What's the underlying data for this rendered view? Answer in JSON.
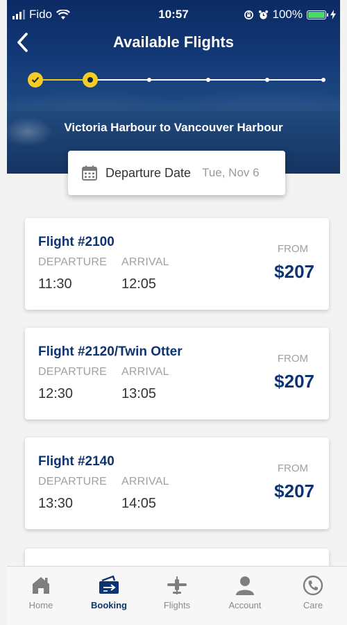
{
  "status_bar": {
    "carrier": "Fido",
    "time": "10:57",
    "battery": "100%"
  },
  "header": {
    "title": "Available Flights",
    "route": "Victoria Harbour to Vancouver Harbour",
    "progress": {
      "total_steps": 6,
      "completed_steps": 1,
      "current_step": 2
    }
  },
  "departure": {
    "label": "Departure Date",
    "value": "Tue, Nov 6"
  },
  "flights": [
    {
      "name": "Flight #2100",
      "departure_label": "DEPARTURE",
      "arrival_label": "ARRIVAL",
      "departure": "11:30",
      "arrival": "12:05",
      "from_label": "FROM",
      "price": "$207"
    },
    {
      "name": "Flight #2120/Twin Otter",
      "departure_label": "DEPARTURE",
      "arrival_label": "ARRIVAL",
      "departure": "12:30",
      "arrival": "13:05",
      "from_label": "FROM",
      "price": "$207"
    },
    {
      "name": "Flight #2140",
      "departure_label": "DEPARTURE",
      "arrival_label": "ARRIVAL",
      "departure": "13:30",
      "arrival": "14:05",
      "from_label": "FROM",
      "price": "$207"
    }
  ],
  "tabs": [
    {
      "label": "Home",
      "icon": "home-icon",
      "active": false
    },
    {
      "label": "Booking",
      "icon": "ticket-icon",
      "active": true
    },
    {
      "label": "Flights",
      "icon": "plane-icon",
      "active": false
    },
    {
      "label": "Account",
      "icon": "user-icon",
      "active": false
    },
    {
      "label": "Care",
      "icon": "phone-icon",
      "active": false
    }
  ],
  "colors": {
    "brand_navy": "#0d3471",
    "progress_yellow": "#f3cc24",
    "battery_green": "#4cd964",
    "muted_gray": "#a0a0a0"
  }
}
